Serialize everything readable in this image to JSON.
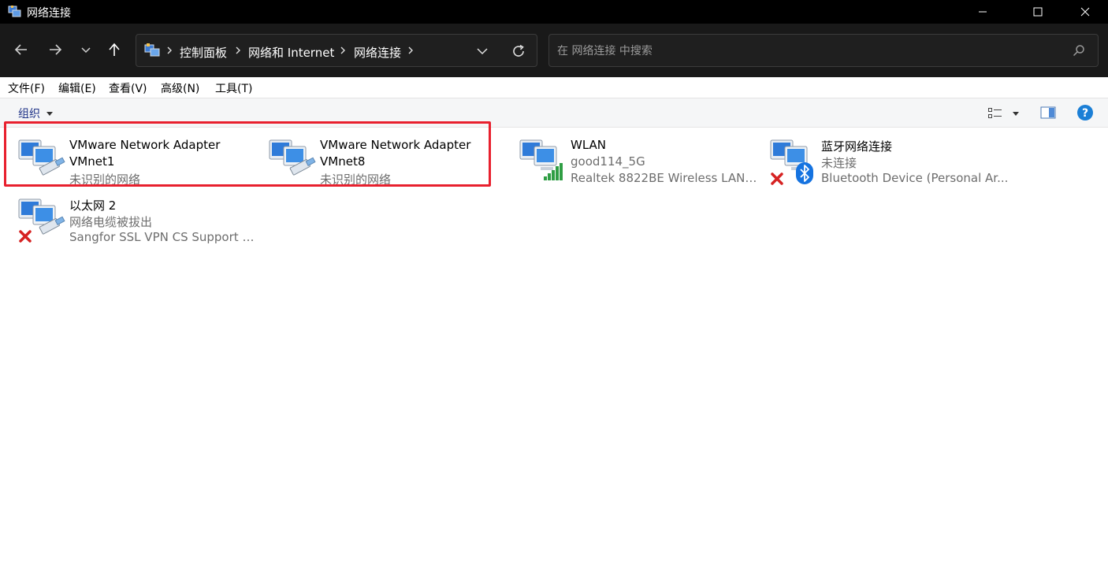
{
  "window": {
    "title": "网络连接"
  },
  "address": {
    "crumbs": [
      "控制面板",
      "网络和 Internet",
      "网络连接"
    ]
  },
  "search": {
    "placeholder": "在 网络连接 中搜索"
  },
  "menu": [
    "文件(F)",
    "编辑(E)",
    "查看(V)",
    "高级(N)",
    "工具(T)"
  ],
  "toolbar": {
    "organize": "组织"
  },
  "items": [
    {
      "name": "VMware Network Adapter",
      "line2": "VMnet1",
      "line3": "未识别的网络",
      "line2_dark": true,
      "status": "ok"
    },
    {
      "name": "VMware Network Adapter",
      "line2": "VMnet8",
      "line3": "未识别的网络",
      "line2_dark": true,
      "status": "ok"
    },
    {
      "name": "WLAN",
      "line2": "good114_5G",
      "line3": "Realtek 8822BE Wireless LAN ...",
      "status": "wireless"
    },
    {
      "name": "蓝牙网络连接",
      "line2": "未连接",
      "line3": "Bluetooth Device (Personal Ar...",
      "status": "bluetooth-disconnected"
    },
    {
      "name": "以太网 2",
      "line2": "网络电缆被拔出",
      "line3": "Sangfor SSL VPN CS Support S...",
      "status": "disconnected"
    }
  ],
  "colors": {
    "highlight": "#e8202e",
    "help": "#1b7fd6",
    "bluetooth": "#1573e0",
    "error": "#d62222",
    "signal": "#2f9e44"
  }
}
